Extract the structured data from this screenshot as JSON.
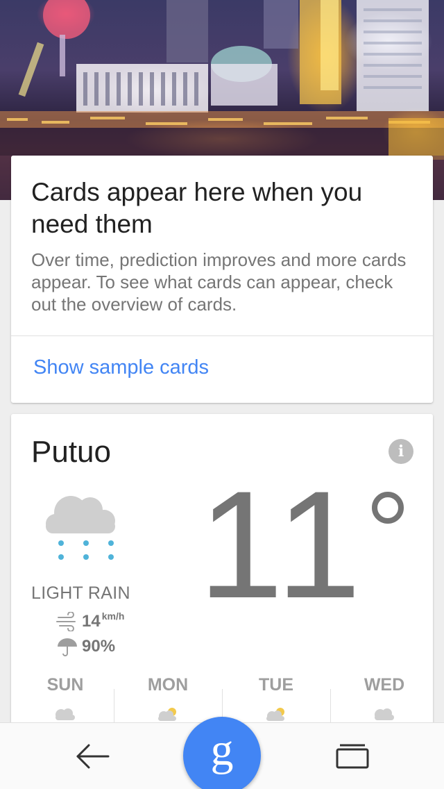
{
  "intro_card": {
    "title": "Cards appear here when you need them",
    "body": "Over time, prediction improves and more cards appear. To see what cards can appear, check out the overview of cards.",
    "link_label": "Show sample cards"
  },
  "weather_card": {
    "city": "Putuo",
    "info_icon": "i",
    "temperature": "11",
    "condition": "LIGHT RAIN",
    "wind_speed": "14",
    "wind_unit": "km/h",
    "precipitation": "90%",
    "forecast": [
      {
        "day": "SUN",
        "icon": "rain-cloud-icon"
      },
      {
        "day": "MON",
        "icon": "sun-cloud-rain-icon"
      },
      {
        "day": "TUE",
        "icon": "sun-cloud-rain-icon"
      },
      {
        "day": "WED",
        "icon": "rain-cloud-icon"
      }
    ]
  },
  "nav": {
    "google_glyph": "g",
    "back_icon": "back-arrow-icon",
    "recents_icon": "recent-apps-icon"
  },
  "colors": {
    "accent": "#4285f4",
    "rain_drop": "#4fb3d9",
    "cloud": "#cfcfcf",
    "secondary_text": "#757575"
  }
}
